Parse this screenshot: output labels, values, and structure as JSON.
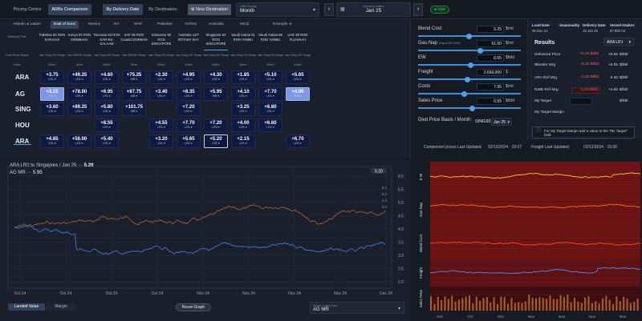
{
  "topbar": {
    "mode_tabs": [
      "Pricing Centre",
      "ARBs Comparison"
    ],
    "view_tabs": [
      "By Delivery Date",
      "By Destination"
    ],
    "new_destination": "New Destination",
    "date_range": {
      "label": "Date Range",
      "value": "Month"
    },
    "delivery_dates": {
      "label": "Delivery Dates",
      "value": "Jan 25"
    },
    "live": "Live"
  },
  "region_tabs": [
    "Atlantic & Latam",
    "East of Suez",
    "Mexico",
    "NY",
    "WAF",
    "Pakistan",
    "AG/SG",
    "Australia",
    "MCQ",
    "Example",
    "+"
  ],
  "grid": {
    "corner": [
      "Delivery Port",
      "Cost Price Basis",
      "Units"
    ],
    "columns": [
      {
        "name": "Pakistan 92 RON",
        "port": "KARACHI",
        "basis": "Jan Sing 92 Swap",
        "unit": "$/bbl"
      },
      {
        "name": "Kenya 93 RON",
        "port": "MOMBASA",
        "basis": "Jan EBOB Swap",
        "unit": "$/mt"
      },
      {
        "name": "Tanzania 93 RON",
        "port": "DAR-ES-SALAAM",
        "basis": "Jan Sing 92 Swap",
        "unit": "$/bbl"
      },
      {
        "name": "SAF 95 RON",
        "port": "Coastal DURBAN",
        "basis": "Jan EBOB Swap",
        "unit": "$/mt"
      },
      {
        "name": "Indonesia 90",
        "port": "RON SINGAPORE",
        "basis": "Jan Sing 92 Swap",
        "unit": "$/bbl"
      },
      {
        "name": "Australia ULP",
        "port": "BOTANY BAY",
        "basis": "Jan Sing 92 Swap",
        "unit": "$/bbl"
      },
      {
        "name": "Singapore 92",
        "port": "RON SINGAPORE",
        "basis": "Jan Sing 92 Swap",
        "unit": "$/bbl"
      },
      {
        "name": "Saudi Arabia 91",
        "port": "RON YANBU",
        "basis": "Jan Sing 92 Swap",
        "unit": "$/bbl"
      },
      {
        "name": "Saudi Arabia 95",
        "port": "RON YANBU",
        "basis": "Jan Sing 92 Swap",
        "unit": "$/bbl"
      },
      {
        "name": "UAE 95 RON",
        "port": "FUJAIRAH",
        "basis": "Jan Sing 92 Swap",
        "unit": "$/bbl"
      }
    ],
    "rows": [
      {
        "label": "ARA",
        "cells": [
          {
            "v": "+3.75",
            "s": "LR1"
          },
          {
            "v": "+49.25",
            "s": "LR1"
          },
          {
            "v": "+4.60",
            "s": "LR1"
          },
          {
            "v": "+75.25",
            "s": "MR"
          },
          {
            "v": "+2.30",
            "s": "LR1"
          },
          {
            "v": "+4.95",
            "s": "LR1"
          },
          {
            "v": "+4.30",
            "s": "LR2"
          },
          {
            "v": "+1.85",
            "s": "LR1"
          },
          {
            "v": "+5.10",
            "s": "LR1"
          },
          {
            "v": "+5.65",
            "s": "LR1"
          }
        ]
      },
      {
        "label": "AG",
        "cells": [
          {
            "v": "+3.15",
            "s": "LR1"
          },
          {
            "v": "+78.00",
            "s": "LR1"
          },
          {
            "v": "+6.95",
            "s": "LR1"
          },
          {
            "v": "+87.75",
            "s": "MR"
          },
          {
            "v": "+3.40",
            "s": "LR1"
          },
          {
            "v": "+8.35",
            "s": "LR1"
          },
          {
            "v": "+5.95",
            "s": "MR"
          },
          {
            "v": "+4.10",
            "s": "LR1"
          },
          {
            "v": "+7.70",
            "s": "LR1"
          },
          {
            "v": "+4.90",
            "s": "FOB"
          }
        ]
      },
      {
        "label": "SING",
        "cells": [
          {
            "v": "+3.60",
            "s": "LR1"
          },
          {
            "v": "+89.25",
            "s": "LR1"
          },
          {
            "v": "+5.80",
            "s": "LR1"
          },
          {
            "v": "+101.75",
            "s": "MR"
          },
          null,
          {
            "v": "+7.20",
            "s": "LR1"
          },
          null,
          {
            "v": "+3.25",
            "s": "LR1"
          },
          {
            "v": "+6.80",
            "s": "LR1"
          },
          null
        ]
      },
      {
        "label": "HOU",
        "cells": [
          null,
          null,
          {
            "v": "+8.55",
            "s": "LR1"
          },
          null,
          {
            "v": "+4.55",
            "s": "LR1"
          },
          {
            "v": "+7.70",
            "s": "LR1"
          },
          {
            "v": "+7.20",
            "s": "LR2"
          },
          {
            "v": "+4.00",
            "s": "LR1"
          },
          {
            "v": "+6.60",
            "s": "LR1"
          },
          null
        ]
      },
      {
        "label": "ARA",
        "cells": [
          {
            "v": "+4.85",
            "s": "LR1"
          },
          {
            "v": "+56.00",
            "s": "LR1"
          },
          {
            "v": "+5.40",
            "s": "LR1"
          },
          null,
          {
            "v": "+3.20",
            "s": "LR1"
          },
          {
            "v": "+5.65",
            "s": "LR1"
          },
          {
            "v": "+5.20",
            "s": "LR2"
          },
          {
            "v": "+2.15",
            "s": "LR1"
          },
          null,
          {
            "v": "+6.70",
            "s": "LR1"
          }
        ]
      }
    ]
  },
  "form": {
    "fields": [
      {
        "label": "Blend Cost",
        "value": "5.25",
        "unit": "$/mt"
      },
      {
        "label": "Gas-Nap",
        "sublabel": "(Nap in tbl+10%)",
        "value": "61.00",
        "unit": "$/mt"
      },
      {
        "label": "EW",
        "value": "0.65",
        "unit": "$/bbl"
      },
      {
        "label": "Freight",
        "value": "2,660,000",
        "unit": "$"
      },
      {
        "label": "Costs",
        "value": "7.95",
        "unit": "$/mt"
      },
      {
        "label": "Sales Price",
        "value": "0.05",
        "unit": "$/bbl"
      }
    ],
    "divd_label": "Divd Price Basis / Month:",
    "divd_basis": "SING92",
    "divd_month": "Jan 25",
    "footer_label": "Component prices Last Updated",
    "footer_time": "02/12/2024 · 19:37"
  },
  "results": {
    "heads": [
      "Load Date",
      "Seasonality",
      "Delivery Date",
      "Vessel Intakes"
    ],
    "head_vals": [
      "05 Dec 24",
      "",
      "15 Jan 25",
      "87,850 mt"
    ],
    "title": "Results",
    "vessel": "ARA LR1",
    "rows": [
      {
        "label": "Delivered Price",
        "v1": "+5.20 $/bbl",
        "v2": "+6.55",
        "v3": "$/bbl"
      },
      {
        "label": "Blender Mrg",
        "v1": "-5.30 $/bbl",
        "v2": "+6.05",
        "v3": "$/bbl"
      },
      {
        "label": "ARA Ref Mrg",
        "v1": "-4.05 $/bbl",
        "v2": "5.40",
        "v3": "$/bbl"
      },
      {
        "label": "NWE Ref Mrg",
        "v1": "-3.10 $/bbl",
        "v2": "+4.65",
        "v3": "$/bbl"
      },
      {
        "label": "My Target",
        "v1": "",
        "v2": "",
        "v3": "$/bbl"
      },
      {
        "label": "My Target Margin",
        "v1": "",
        "v2": "",
        "v3": ""
      }
    ],
    "note": "For My Target Margin add a value to the \"My Target\" field",
    "footer_label": "Freight Last Updated",
    "footer_time": "03/12/2024 · 15:36"
  },
  "chart_left": {
    "title": "ARA LR2 to Singapore / Jan 25",
    "title_value": "5.20",
    "sub": "AG MR",
    "sub_value": "5.95",
    "x_ticks": [
      "Oct 24",
      "Oct 24",
      "Oct 24",
      "Oct 24",
      "Nov 24",
      "Nov 24",
      "Nov 24",
      "Nov 24",
      "Dec 24"
    ],
    "y_ticks": [
      "6.0",
      "5.5",
      "5.0",
      "4.5",
      "4.0",
      "3.5",
      "3.0",
      "2.5",
      "2.0"
    ],
    "right_ticks": [
      "5.5",
      "5.0",
      "4.5",
      "4.0"
    ],
    "tabs": [
      "Landed Value",
      "Margin"
    ],
    "reset": "Reset Graph",
    "other_ports_label": "Other Load Ports",
    "other_ports_value": "AG MR"
  },
  "chart_data": [
    {
      "type": "line",
      "title": "ARA LR2 to Singapore / Jan 25",
      "series": [
        {
          "name": "ARA LR2 to Singapore / Jan 25"
        },
        {
          "name": "AG MR"
        }
      ],
      "x_ticks": [
        "Oct 24",
        "Nov 24",
        "Dec 24"
      ],
      "y_range": [
        2.0,
        6.0
      ]
    },
    {
      "type": "line",
      "series": [
        {
          "name": "EW"
        },
        {
          "name": "Gas-Nap"
        },
        {
          "name": "Blend Cost"
        },
        {
          "name": "Freight"
        },
        {
          "name": "Sales Price"
        }
      ],
      "x_ticks": [
        "Oct",
        "Oct",
        "Oct",
        "Nov",
        "Nov",
        "Nov",
        "Nov"
      ]
    }
  ],
  "chart_right": {
    "labels": [
      "E W",
      "Gas-Nap",
      "Blend Cost",
      "Freight",
      "Sales Price"
    ],
    "x_ticks": [
      "Oct",
      "Oct",
      "Oct",
      "Nov",
      "Nov",
      "Nov",
      "Nov"
    ]
  }
}
